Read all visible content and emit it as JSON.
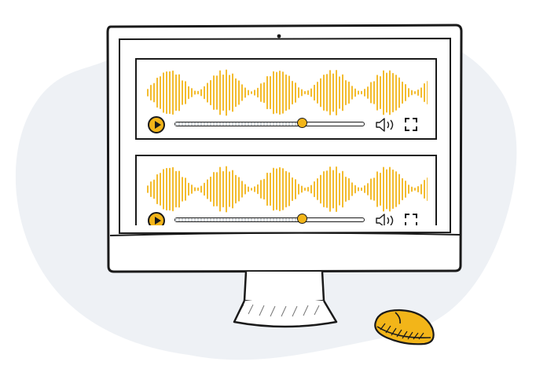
{
  "colors": {
    "accent": "#f2b519",
    "outline": "#1a1a1a",
    "background_blob": "#eef1f5",
    "screen_bg": "#ffffff"
  },
  "players": [
    {
      "progress": 0.67,
      "icons": [
        "play-icon",
        "volume-icon",
        "fullscreen-icon"
      ]
    },
    {
      "progress": 0.67,
      "icons": [
        "play-icon",
        "volume-icon",
        "fullscreen-icon"
      ]
    }
  ],
  "decor": {
    "icons": [
      "monitor-illustration",
      "computer-mouse-icon",
      "webcam-dot"
    ]
  }
}
